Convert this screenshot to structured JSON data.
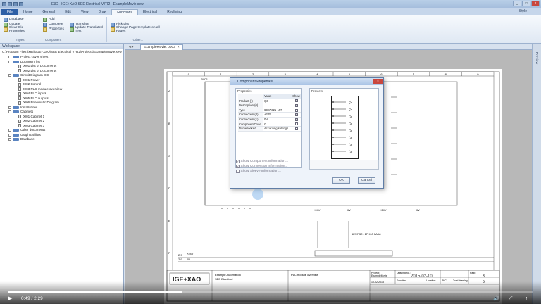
{
  "app": {
    "window_title": "E3D - IGE+XAO SEE Electrical V7R2 - ExampleMovie.sew",
    "style_label": "Style"
  },
  "ribbon_tabs": [
    "File",
    "Home",
    "General",
    "Edit",
    "View",
    "Draw",
    "Functions",
    "Electrical",
    "Redlining"
  ],
  "active_tab": "Functions",
  "ribbon": {
    "types": {
      "title": "Types",
      "items": [
        "Database",
        "Update",
        "Clear Old Properties"
      ]
    },
    "component": {
      "title": "Component",
      "items": [
        "Add",
        "Complete",
        "Properties"
      ]
    },
    "translate": {
      "title": "",
      "items": [
        "Translate",
        "Update Translated Text"
      ]
    },
    "other": {
      "title": "Other...",
      "items": [
        "Pick List",
        "Change Page template on all Pages"
      ]
    }
  },
  "workspace": {
    "title": "Workspace",
    "path": "C:\\Program Files (x86)\\IGE+XAO\\SEE Electrical V7R2\\Projects\\ExampleMovie.sew",
    "tree": [
      {
        "label": "Project cover sheet",
        "kind": "folder",
        "level": 1
      },
      {
        "label": "Document list",
        "kind": "folder",
        "level": 1
      },
      {
        "label": "0001 List of Documents",
        "kind": "file",
        "level": 2
      },
      {
        "label": "0002 List of Documents",
        "kind": "file",
        "level": 2
      },
      {
        "label": "Circuit Diagram IEC",
        "kind": "folder",
        "level": 1
      },
      {
        "label": "0001 Power",
        "kind": "file",
        "level": 2
      },
      {
        "label": "0002 Control",
        "kind": "file",
        "level": 2
      },
      {
        "label": "0003 PLC module overview",
        "kind": "file",
        "level": 2
      },
      {
        "label": "0004 PLC inputs",
        "kind": "file",
        "level": 2
      },
      {
        "label": "0005 PLC outputs",
        "kind": "file",
        "level": 2
      },
      {
        "label": "0006 Pneumatic Diagram",
        "kind": "file",
        "level": 2
      },
      {
        "label": "Installations",
        "kind": "folder",
        "level": 1
      },
      {
        "label": "Cabinets",
        "kind": "folder",
        "level": 1
      },
      {
        "label": "0001 Cabinet 1",
        "kind": "file",
        "level": 2
      },
      {
        "label": "0002 Cabinet 2",
        "kind": "file",
        "level": 2
      },
      {
        "label": "0003 Cabinet 3",
        "kind": "file",
        "level": 2
      },
      {
        "label": "Other documents",
        "kind": "folder",
        "level": 1
      },
      {
        "label": "Graphical lists",
        "kind": "folder",
        "level": 1
      },
      {
        "label": "Database",
        "kind": "folder",
        "level": 1
      }
    ]
  },
  "document_tab": "ExampleMovie: 0003",
  "preview_strip": "Preview",
  "dialog": {
    "title": "Component Properties",
    "properties_label": "Properties",
    "preview_label": "Preview",
    "columns": [
      "",
      "Value",
      "Show"
    ],
    "rows": [
      {
        "name": "Product (-)",
        "value": "Q3",
        "show": true
      },
      {
        "name": "Description (0)",
        "value": "",
        "show": true
      },
      {
        "name": "Type",
        "value": "6ES7321-1FF",
        "show": false
      },
      {
        "name": "Connection (0)",
        "value": "+24V",
        "show": true
      },
      {
        "name": "Connection (1)",
        "value": "0V",
        "show": true
      },
      {
        "name": "ComponentCode",
        "value": "G",
        "show": false
      },
      {
        "name": "Name locked",
        "value": "According settings",
        "show": false
      }
    ],
    "options": [
      {
        "label": "Show Component Information...",
        "checked": true
      },
      {
        "label": "Show Connection Information...",
        "checked": true
      },
      {
        "label": "Show Sleeve Information...",
        "checked": false
      }
    ],
    "ok": "OK",
    "cancel": "Cancel"
  },
  "drawing": {
    "col_numbers": [
      "0",
      "1",
      "2",
      "3",
      "4",
      "5",
      "6",
      "7",
      "8",
      "9"
    ],
    "row_letters": [
      "A",
      "B",
      "C",
      "D",
      "E",
      "F"
    ],
    "labels": [
      "+24V",
      "0V",
      "+24V",
      "0V",
      "+24V",
      "2.9",
      "+24V",
      "2.9",
      "0V"
    ],
    "plc_text": "PLC1",
    "part_text": "6ES7 321 1FH00 0AA0",
    "title_block": {
      "logo": "IGE+XAO",
      "company": "Example Automation",
      "company2": "SEE Electrical",
      "page_title": "PLC module overview",
      "project_label": "Project:",
      "project_value": "ExampleMovie",
      "drawing_label": "Drawing no.:",
      "date_value": "2015-02-10",
      "page_label": "Page:",
      "page_value": "3",
      "date2": "10-02-2015",
      "function_label": "Function:",
      "location_label": "Location:",
      "drawing_value": "PLC",
      "total_label": "Total drawing:",
      "total_value": "5"
    }
  },
  "video": {
    "time": "0:49 / 2:29",
    "progress": 0.33,
    "buffered": 0.4
  }
}
